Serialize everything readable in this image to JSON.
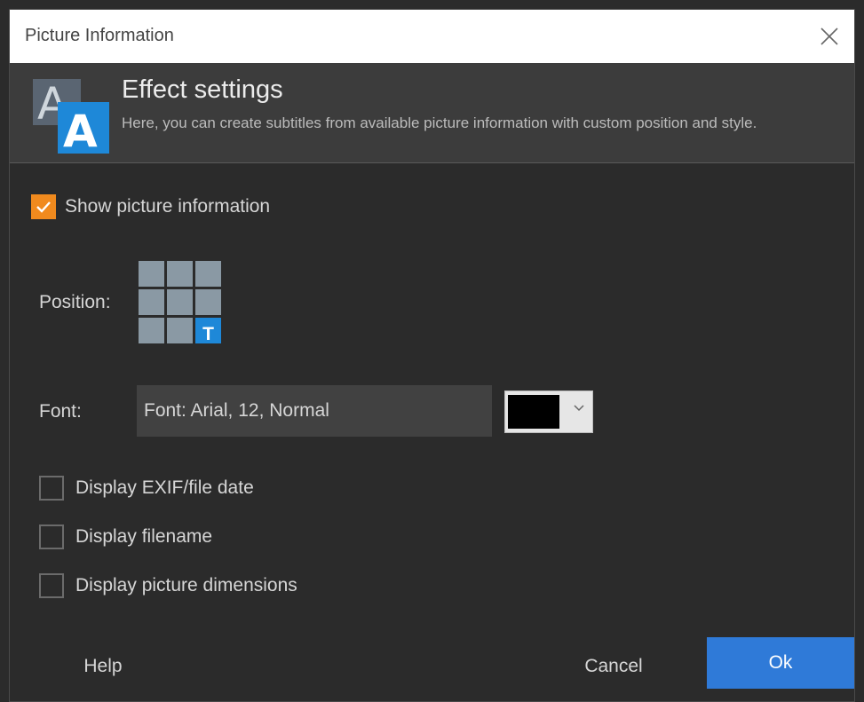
{
  "window": {
    "title": "Picture Information",
    "close_icon": "close-icon"
  },
  "header": {
    "title": "Effect settings",
    "description": "Here, you can create subtitles from available picture information with custom position and style.",
    "logo_icon": "text-effect-icon",
    "logo_letter_back": "A",
    "logo_letter_front": "A",
    "accent_color": "#1e88d8"
  },
  "settings": {
    "show_picture_information": {
      "label": "Show picture information",
      "checked": true,
      "check_color": "#f08a1e"
    },
    "position": {
      "label": "Position:",
      "grid_rows": 3,
      "grid_cols": 3,
      "selected_cell": "bottom-right",
      "selected_marker": "T"
    },
    "font": {
      "label": "Font:",
      "value": "Font: Arial, 12, Normal",
      "color": "#000000"
    },
    "options": [
      {
        "label": "Display EXIF/file date",
        "checked": false
      },
      {
        "label": "Display filename",
        "checked": false
      },
      {
        "label": "Display picture dimensions",
        "checked": false
      }
    ]
  },
  "footer": {
    "help_label": "Help",
    "cancel_label": "Cancel",
    "ok_label": "Ok",
    "ok_color": "#2f7ad8"
  }
}
